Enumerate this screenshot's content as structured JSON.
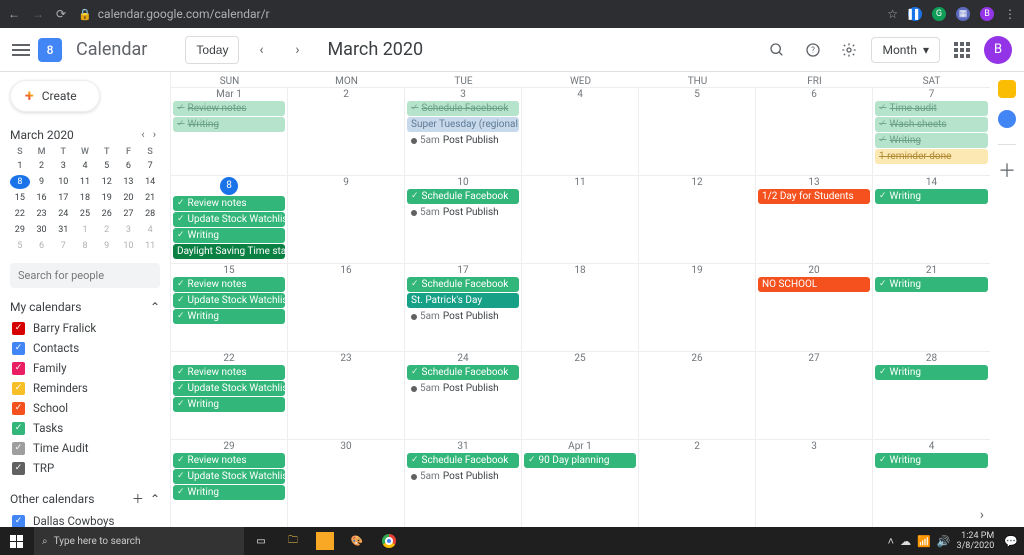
{
  "browser": {
    "url": "calendar.google.com/calendar/r",
    "avatar_letter": "B"
  },
  "header": {
    "logo_day": "8",
    "product": "Calendar",
    "today_label": "Today",
    "month_title": "March 2020",
    "view_label": "Month",
    "avatar_letter": "B"
  },
  "sidebar": {
    "create_label": "Create",
    "mini_month": "March 2020",
    "mini_dow": [
      "S",
      "M",
      "T",
      "W",
      "T",
      "F",
      "S"
    ],
    "mini_days": [
      {
        "n": "1"
      },
      {
        "n": "2"
      },
      {
        "n": "3"
      },
      {
        "n": "4"
      },
      {
        "n": "5"
      },
      {
        "n": "6"
      },
      {
        "n": "7"
      },
      {
        "n": "8",
        "today": true
      },
      {
        "n": "9"
      },
      {
        "n": "10"
      },
      {
        "n": "11"
      },
      {
        "n": "12"
      },
      {
        "n": "13"
      },
      {
        "n": "14"
      },
      {
        "n": "15"
      },
      {
        "n": "16"
      },
      {
        "n": "17"
      },
      {
        "n": "18"
      },
      {
        "n": "19"
      },
      {
        "n": "20"
      },
      {
        "n": "21"
      },
      {
        "n": "22"
      },
      {
        "n": "23"
      },
      {
        "n": "24"
      },
      {
        "n": "25"
      },
      {
        "n": "26"
      },
      {
        "n": "27"
      },
      {
        "n": "28"
      },
      {
        "n": "29"
      },
      {
        "n": "30"
      },
      {
        "n": "31"
      },
      {
        "n": "1",
        "dim": true
      },
      {
        "n": "2",
        "dim": true
      },
      {
        "n": "3",
        "dim": true
      },
      {
        "n": "4",
        "dim": true
      },
      {
        "n": "5",
        "dim": true
      },
      {
        "n": "6",
        "dim": true
      },
      {
        "n": "7",
        "dim": true
      },
      {
        "n": "8",
        "dim": true
      },
      {
        "n": "9",
        "dim": true
      },
      {
        "n": "10",
        "dim": true
      },
      {
        "n": "11",
        "dim": true
      }
    ],
    "search_placeholder": "Search for people",
    "my_calendars_label": "My calendars",
    "other_calendars_label": "Other calendars",
    "calendars": [
      {
        "name": "Barry Fralick",
        "color": "#d50000"
      },
      {
        "name": "Contacts",
        "color": "#4285f4"
      },
      {
        "name": "Family",
        "color": "#e91e63"
      },
      {
        "name": "Reminders",
        "color": "#f6bf26"
      },
      {
        "name": "School",
        "color": "#f4511e"
      },
      {
        "name": "Tasks",
        "color": "#33b679"
      },
      {
        "name": "Time Audit",
        "color": "#9e9e9e"
      },
      {
        "name": "TRP",
        "color": "#616161"
      }
    ],
    "other_calendars": [
      {
        "name": "Dallas Cowboys",
        "color": "#4285f4"
      }
    ]
  },
  "grid": {
    "dow": [
      "SUN",
      "MON",
      "TUE",
      "WED",
      "THU",
      "FRI",
      "SAT"
    ],
    "weeks": [
      [
        {
          "label": "Mar 1",
          "events": [
            {
              "t": "Review notes",
              "cls": "green-dim",
              "chk": true
            },
            {
              "t": "Writing",
              "cls": "green-dim",
              "chk": true
            }
          ]
        },
        {
          "label": "2",
          "events": []
        },
        {
          "label": "3",
          "events": [
            {
              "t": "Schedule Facebook",
              "cls": "green-dim",
              "chk": true
            },
            {
              "t": "Super Tuesday (regional holiday)",
              "cls": "blue-dim"
            },
            {
              "t": "Post Publish",
              "cls": "timed",
              "time": "5am",
              "dot": "#616161"
            }
          ]
        },
        {
          "label": "4",
          "events": []
        },
        {
          "label": "5",
          "events": []
        },
        {
          "label": "6",
          "events": []
        },
        {
          "label": "7",
          "events": [
            {
              "t": "Time audit",
              "cls": "green-dim",
              "chk": true
            },
            {
              "t": "Wash sheets",
              "cls": "green-dim",
              "chk": true
            },
            {
              "t": "Writing",
              "cls": "green-dim",
              "chk": true
            },
            {
              "t": "1 reminder done",
              "cls": "yellow-dim"
            }
          ]
        }
      ],
      [
        {
          "label": "8",
          "today": true,
          "events": [
            {
              "t": "Review notes",
              "cls": "green",
              "chk": true
            },
            {
              "t": "Update Stock Watchlist",
              "cls": "green",
              "chk": true
            },
            {
              "t": "Writing",
              "cls": "green",
              "chk": true
            },
            {
              "t": "Daylight Saving Time starts",
              "cls": "teal"
            }
          ]
        },
        {
          "label": "9",
          "events": []
        },
        {
          "label": "10",
          "events": [
            {
              "t": "Schedule Facebook",
              "cls": "green",
              "chk": true
            },
            {
              "t": "Post Publish",
              "cls": "timed",
              "time": "5am",
              "dot": "#616161"
            }
          ]
        },
        {
          "label": "11",
          "events": []
        },
        {
          "label": "12",
          "events": []
        },
        {
          "label": "13",
          "events": [
            {
              "t": "1/2 Day for Students",
              "cls": "orange"
            }
          ]
        },
        {
          "label": "14",
          "events": [
            {
              "t": "Writing",
              "cls": "green",
              "chk": true
            }
          ]
        }
      ],
      [
        {
          "label": "15",
          "events": [
            {
              "t": "Review notes",
              "cls": "green",
              "chk": true
            },
            {
              "t": "Update Stock Watchlist",
              "cls": "green",
              "chk": true
            },
            {
              "t": "Writing",
              "cls": "green",
              "chk": true
            }
          ]
        },
        {
          "label": "16",
          "events": []
        },
        {
          "label": "17",
          "events": [
            {
              "t": "Schedule Facebook",
              "cls": "green",
              "chk": true
            },
            {
              "t": "St. Patrick's Day",
              "cls": "teal2"
            },
            {
              "t": "Post Publish",
              "cls": "timed",
              "time": "5am",
              "dot": "#616161"
            }
          ]
        },
        {
          "label": "18",
          "events": []
        },
        {
          "label": "19",
          "events": []
        },
        {
          "label": "20",
          "events": [
            {
              "t": "NO SCHOOL",
              "cls": "orange"
            }
          ]
        },
        {
          "label": "21",
          "events": [
            {
              "t": "Writing",
              "cls": "green",
              "chk": true
            }
          ]
        }
      ],
      [
        {
          "label": "22",
          "events": [
            {
              "t": "Review notes",
              "cls": "green",
              "chk": true
            },
            {
              "t": "Update Stock Watchlist",
              "cls": "green",
              "chk": true
            },
            {
              "t": "Writing",
              "cls": "green",
              "chk": true
            }
          ]
        },
        {
          "label": "23",
          "events": []
        },
        {
          "label": "24",
          "events": [
            {
              "t": "Schedule Facebook",
              "cls": "green",
              "chk": true
            },
            {
              "t": "Post Publish",
              "cls": "timed",
              "time": "5am",
              "dot": "#616161"
            }
          ]
        },
        {
          "label": "25",
          "events": []
        },
        {
          "label": "26",
          "events": []
        },
        {
          "label": "27",
          "events": []
        },
        {
          "label": "28",
          "events": [
            {
              "t": "Writing",
              "cls": "green",
              "chk": true
            }
          ]
        }
      ],
      [
        {
          "label": "29",
          "events": [
            {
              "t": "Review notes",
              "cls": "green",
              "chk": true
            },
            {
              "t": "Update Stock Watchlist",
              "cls": "green",
              "chk": true
            },
            {
              "t": "Writing",
              "cls": "green",
              "chk": true
            }
          ]
        },
        {
          "label": "30",
          "events": []
        },
        {
          "label": "31",
          "events": [
            {
              "t": "Schedule Facebook",
              "cls": "green",
              "chk": true
            },
            {
              "t": "Post Publish",
              "cls": "timed",
              "time": "5am",
              "dot": "#616161"
            }
          ]
        },
        {
          "label": "Apr 1",
          "events": [
            {
              "t": "90 Day planning",
              "cls": "green",
              "chk": true
            }
          ]
        },
        {
          "label": "2",
          "events": []
        },
        {
          "label": "3",
          "events": []
        },
        {
          "label": "4",
          "events": [
            {
              "t": "Writing",
              "cls": "green",
              "chk": true
            }
          ]
        }
      ]
    ]
  },
  "taskbar": {
    "search_placeholder": "Type here to search",
    "time": "1:24 PM",
    "date": "3/8/2020"
  }
}
